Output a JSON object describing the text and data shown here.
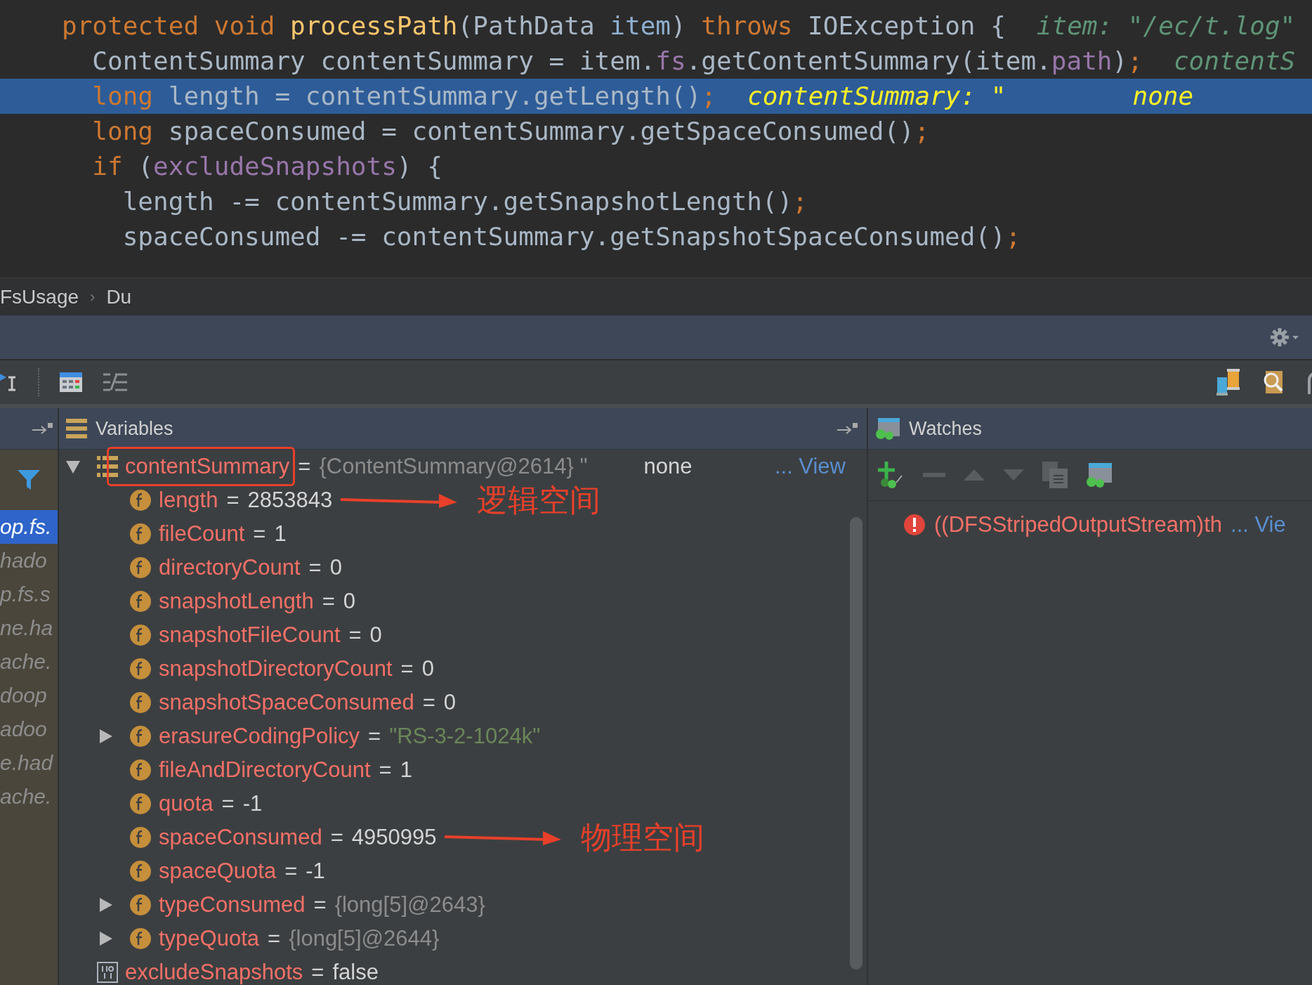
{
  "editor": {
    "lines": [
      {
        "selected": false,
        "tokens": [
          {
            "kind": "kw",
            "text": "protected void "
          },
          {
            "kind": "method",
            "text": "processPath"
          },
          {
            "kind": "plain",
            "text": "(PathData "
          },
          {
            "kind": "param",
            "text": "item"
          },
          {
            "kind": "plain",
            "text": ") "
          },
          {
            "kind": "kw",
            "text": "throws "
          },
          {
            "kind": "plain",
            "text": "IOException {"
          }
        ],
        "hints": [
          "item: \"/ec/t.log\""
        ]
      },
      {
        "selected": false,
        "tokens": [
          {
            "kind": "plain",
            "text": "  ContentSummary contentSummary = item."
          },
          {
            "kind": "field",
            "text": "fs"
          },
          {
            "kind": "plain",
            "text": ".getContentSummary(item."
          },
          {
            "kind": "field",
            "text": "path"
          },
          {
            "kind": "plain",
            "text": ")"
          },
          {
            "kind": "kw",
            "text": ";"
          }
        ],
        "hints": [
          "contentS"
        ]
      },
      {
        "selected": true,
        "tokens": [
          {
            "kind": "kw",
            "text": "  long "
          },
          {
            "kind": "plain",
            "text": "length = contentSummary.getLength()"
          },
          {
            "kind": "kw",
            "text": ";"
          }
        ],
        "hints": [
          "contentSummary: \"",
          "none"
        ]
      },
      {
        "selected": false,
        "tokens": [
          {
            "kind": "kw",
            "text": "  long "
          },
          {
            "kind": "plain",
            "text": "spaceConsumed = contentSummary.getSpaceConsumed()"
          },
          {
            "kind": "kw",
            "text": ";"
          }
        ]
      },
      {
        "selected": false,
        "tokens": [
          {
            "kind": "kw",
            "text": "  if "
          },
          {
            "kind": "plain",
            "text": "("
          },
          {
            "kind": "field",
            "text": "excludeSnapshots"
          },
          {
            "kind": "plain",
            "text": ") {"
          }
        ]
      },
      {
        "selected": false,
        "tokens": [
          {
            "kind": "plain",
            "text": "    length -= contentSummary.getSnapshotLength()"
          },
          {
            "kind": "kw",
            "text": ";"
          }
        ]
      },
      {
        "selected": false,
        "tokens": [
          {
            "kind": "plain",
            "text": "    spaceConsumed -= contentSummary.getSnapshotSpaceConsumed()"
          },
          {
            "kind": "kw",
            "text": ";"
          }
        ]
      }
    ]
  },
  "breadcrumb": {
    "items": [
      "FsUsage",
      "Du"
    ],
    "separator": "›"
  },
  "debugger": {
    "frames": [
      {
        "text": "op.fs.",
        "selected": true
      },
      {
        "text": "hado",
        "selected": false
      },
      {
        "text": "p.fs.s",
        "selected": false
      },
      {
        "text": "ne.ha",
        "selected": false
      },
      {
        "text": "ache.",
        "selected": false
      },
      {
        "text": "doop",
        "selected": false
      },
      {
        "text": "adoo",
        "selected": false
      },
      {
        "text": "e.had",
        "selected": false
      },
      {
        "text": "ache.",
        "selected": false
      }
    ],
    "variables_title": "Variables",
    "variables": [
      {
        "kind": "local-object",
        "name": "contentSummary",
        "operator": "=",
        "value": "{ContentSummary@2614} \"",
        "extra": "none",
        "link": "... View",
        "expanded": true,
        "highlighted": true,
        "children": [
          {
            "kind": "field-number",
            "name": "length",
            "operator": "=",
            "value": "2853843",
            "annotation": "逻辑空间"
          },
          {
            "kind": "field-number",
            "name": "fileCount",
            "operator": "=",
            "value": "1"
          },
          {
            "kind": "field-number",
            "name": "directoryCount",
            "operator": "=",
            "value": "0"
          },
          {
            "kind": "field-number",
            "name": "snapshotLength",
            "operator": "=",
            "value": "0"
          },
          {
            "kind": "field-number",
            "name": "snapshotFileCount",
            "operator": "=",
            "value": "0"
          },
          {
            "kind": "field-number",
            "name": "snapshotDirectoryCount",
            "operator": "=",
            "value": "0"
          },
          {
            "kind": "field-number",
            "name": "snapshotSpaceConsumed",
            "operator": "=",
            "value": "0"
          },
          {
            "kind": "field-string",
            "name": "erasureCodingPolicy",
            "operator": "=",
            "value": "\"RS-3-2-1024k\"",
            "expanded": false
          },
          {
            "kind": "field-number",
            "name": "fileAndDirectoryCount",
            "operator": "=",
            "value": "1"
          },
          {
            "kind": "field-number",
            "name": "quota",
            "operator": "=",
            "value": "-1"
          },
          {
            "kind": "field-number",
            "name": "spaceConsumed",
            "operator": "=",
            "value": "4950995",
            "annotation": "物理空间"
          },
          {
            "kind": "field-number",
            "name": "spaceQuota",
            "operator": "=",
            "value": "-1"
          },
          {
            "kind": "field-object",
            "name": "typeConsumed",
            "operator": "=",
            "value": "{long[5]@2643}",
            "expanded": false
          },
          {
            "kind": "field-object",
            "name": "typeQuota",
            "operator": "=",
            "value": "{long[5]@2644}",
            "expanded": false
          }
        ]
      },
      {
        "kind": "local-primitive",
        "name": "excludeSnapshots",
        "operator": "=",
        "value": "false"
      }
    ],
    "watches_title": "Watches",
    "watches": [
      {
        "kind": "error",
        "expression": "((DFSStripedOutputStream)th",
        "link": "... Vie"
      }
    ]
  }
}
